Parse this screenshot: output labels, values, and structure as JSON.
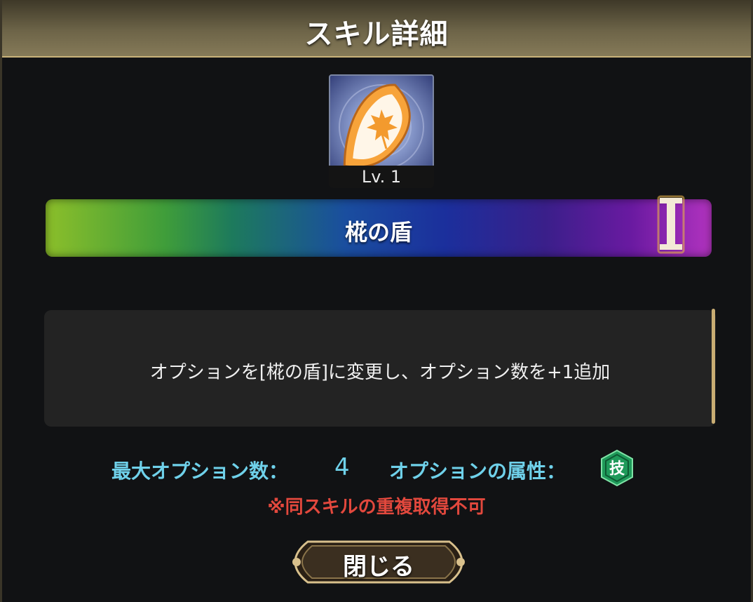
{
  "header": {
    "title": "スキル詳細"
  },
  "skill": {
    "icon": "maple-leaf-shield-icon",
    "level": "Lv. 1",
    "name": "椛の盾",
    "rank_mark": "I",
    "description": "オプションを[椛の盾]に変更し、オプション数を+1追加"
  },
  "stats": {
    "max_options_label": "最大オプション数：",
    "max_options_value": "4",
    "attribute_label": "オプションの属性：",
    "attribute_icon": "technique-attribute-icon",
    "attribute_glyph": "技"
  },
  "note": "※同スキルの重複取得不可",
  "close_button": {
    "label": "閉じる"
  },
  "colors": {
    "accent_gold": "#c9ad73",
    "stat_text": "#6fd1ea",
    "warning_text": "#e2483d",
    "attribute_green": "#1f9a5a"
  }
}
